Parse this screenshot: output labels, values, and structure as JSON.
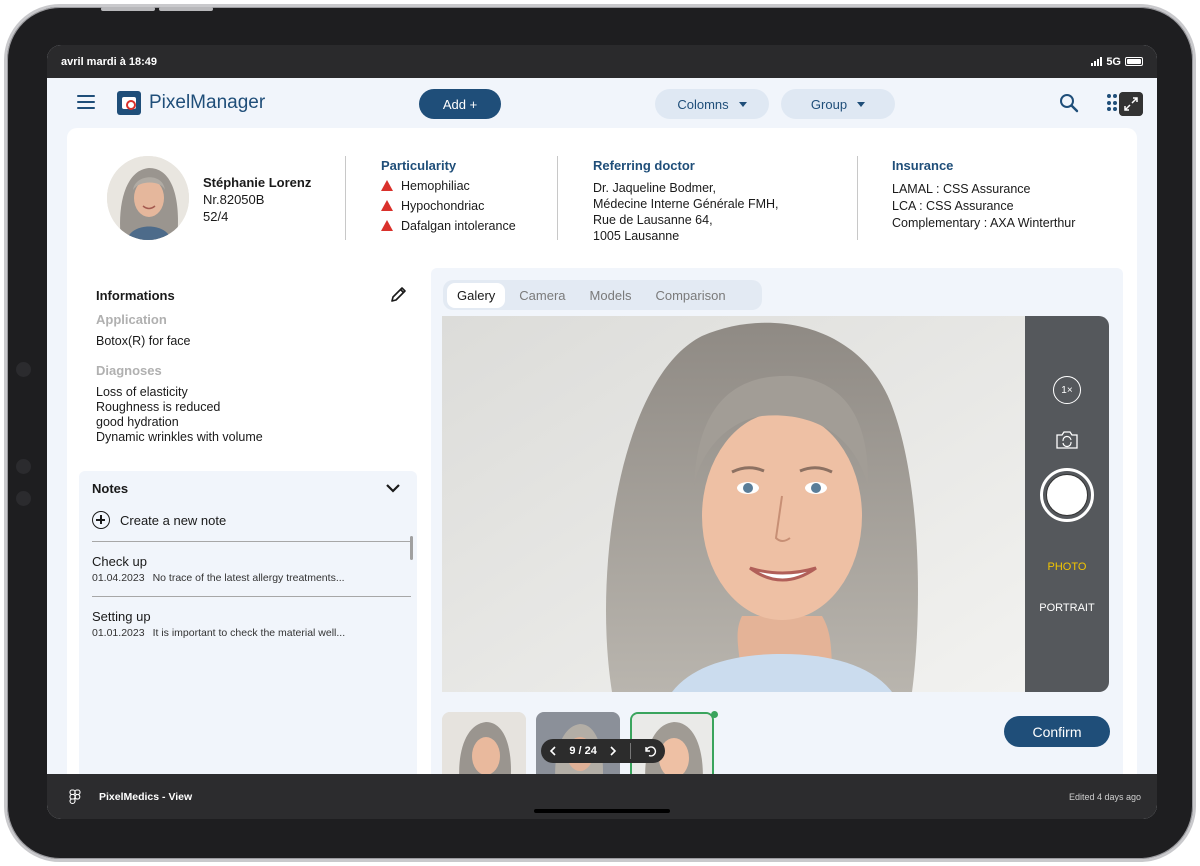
{
  "status_bar": {
    "time": "avril mardi à 18:49",
    "network": "5G"
  },
  "app": {
    "logo_text": "PixelManager",
    "add_label": "Add +",
    "columns_label": "Colomns",
    "group_label": "Group"
  },
  "patient": {
    "name": "Stéphanie Lorenz",
    "number": "Nr.82050B",
    "room": "52/4"
  },
  "particularity": {
    "title": "Particularity",
    "items": [
      "Hemophiliac",
      "Hypochondriac",
      "Dafalgan intolerance"
    ]
  },
  "referring_doctor": {
    "title": "Referring doctor",
    "lines": [
      "Dr. Jaqueline Bodmer,",
      "Médecine Interne Générale FMH,",
      "Rue de Lausanne 64,",
      "1005 Lausanne"
    ]
  },
  "insurance": {
    "title": "Insurance",
    "lines": [
      "LAMAL : CSS Assurance",
      "LCA : CSS Assurance",
      "Complementary : AXA Winterthur"
    ]
  },
  "informations": {
    "title": "Informations",
    "application_label": "Application",
    "application_value": "Botox(R) for face",
    "diagnoses_label": "Diagnoses",
    "diagnoses": [
      "Loss of elasticity",
      "Roughness is reduced",
      "good hydration",
      "Dynamic wrinkles with volume"
    ]
  },
  "notes": {
    "title": "Notes",
    "create_label": "Create a new note",
    "items": [
      {
        "title": "Check up",
        "date": "01.04.2023",
        "text": "No trace of the latest allergy treatments..."
      },
      {
        "title": "Setting up",
        "date": "01.01.2023",
        "text": "It is important to check the material well..."
      }
    ]
  },
  "gallery": {
    "tabs": [
      "Galery",
      "Camera",
      "Models",
      "Comparison"
    ],
    "active_tab": "Galery",
    "zoom": "1×",
    "mode_photo": "PHOTO",
    "mode_portrait": "PORTRAIT",
    "pager": "9 / 24",
    "confirm_label": "Confirm"
  },
  "bottom_bar": {
    "left": "PixelMedics - View",
    "right": "Edited 4 days ago"
  },
  "colors": {
    "primary": "#1f4e79",
    "alert": "#d9312b",
    "photo_mode": "#f2c500",
    "selected": "#3aa45d"
  }
}
